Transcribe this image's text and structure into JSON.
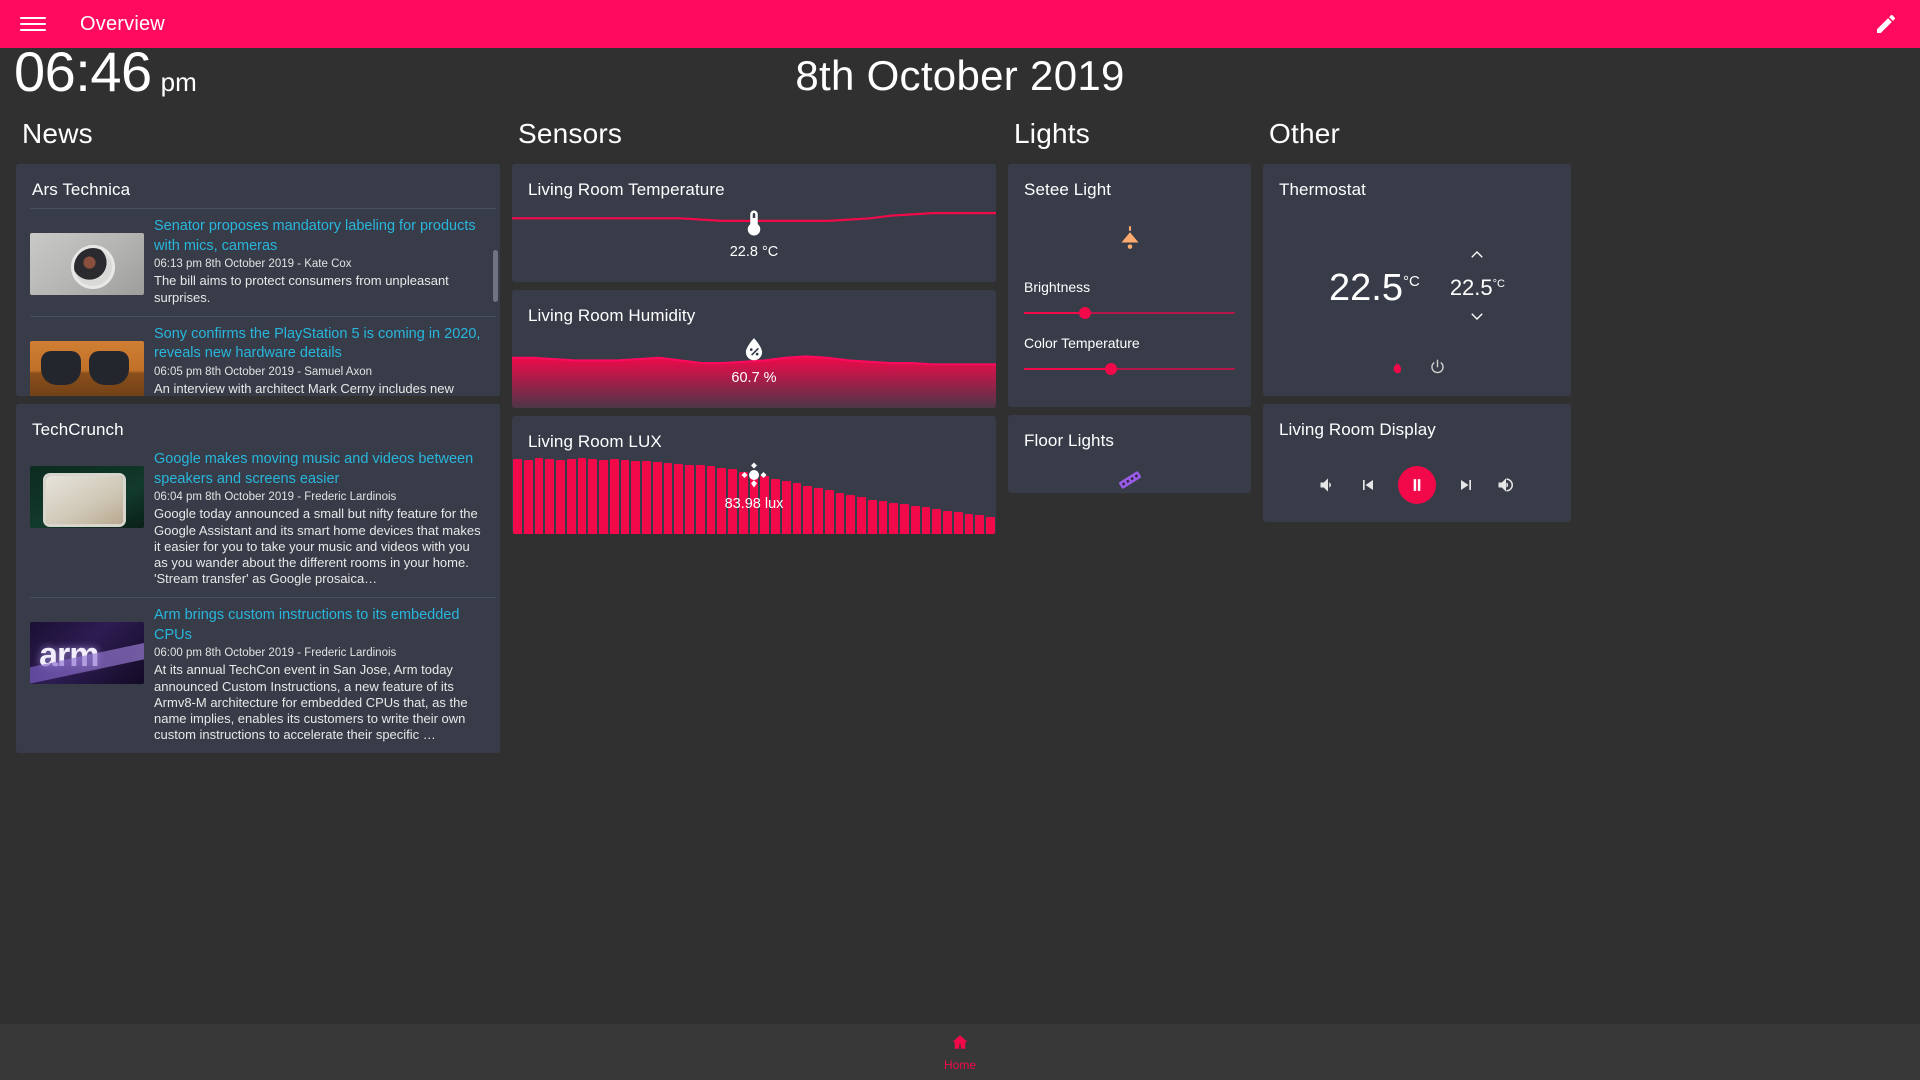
{
  "appbar": {
    "title": "Overview",
    "menu_icon": "hamburger-menu-icon",
    "edit_icon": "pencil-edit-icon"
  },
  "header": {
    "time": "06:46",
    "ampm": "pm",
    "date": "8th October 2019"
  },
  "columns": {
    "news_title": "News",
    "sensors_title": "Sensors",
    "lights_title": "Lights",
    "other_title": "Other"
  },
  "news": [
    {
      "source": "Ars Technica",
      "items": [
        {
          "headline": "Senator proposes mandatory labeling for products with mics, cameras",
          "meta": "06:13 pm 8th October 2019 - Kate Cox",
          "desc": "The bill aims to protect consumers from unpleasant surprises.",
          "thumb": "security-camera-image"
        },
        {
          "headline": "Sony confirms the PlayStation 5 is coming in 2020, reveals new hardware details",
          "meta": "06:05 pm 8th October 2019 - Samuel Axon",
          "desc": "An interview with architect Mark Cerny includes new hardware and software details.",
          "thumb": "playstation-controllers-image"
        }
      ]
    },
    {
      "source": "TechCrunch",
      "items": [
        {
          "headline": "Google makes moving music and videos between speakers and screens easier",
          "meta": "06:04 pm 8th October 2019 - Frederic Lardinois",
          "desc": "Google today announced a small but nifty feature for the Google Assistant and its smart home devices that makes it easier for you to take your music and videos with you as you wander about the different rooms in your home. 'Stream transfer' as Google prosaica…",
          "thumb": "tablet-image"
        },
        {
          "headline": "Arm brings custom instructions to its embedded CPUs",
          "meta": "06:00 pm 8th October 2019 - Frederic Lardinois",
          "desc": "At its annual TechCon event in San Jose, Arm today announced Custom Instructions, a new feature of its Armv8-M architecture for embedded CPUs that, as the name implies, enables its customers to write their own custom instructions to accelerate their specific …",
          "thumb": "arm-logo-image"
        }
      ]
    }
  ],
  "sensors": [
    {
      "title": "Living Room Temperature",
      "value": "22.8 °C",
      "icon": "thermometer-icon",
      "style": "line"
    },
    {
      "title": "Living Room Humidity",
      "value": "60.7 %",
      "icon": "water-percent-icon",
      "style": "area"
    },
    {
      "title": "Living Room LUX",
      "value": "83.98 lux",
      "icon": "brightness-icon",
      "style": "bars"
    }
  ],
  "lights": [
    {
      "title": "Setee Light",
      "icon": "ceiling-light-icon",
      "icon_color": "#ffab70",
      "brightness_label": "Brightness",
      "brightness_pct": 29,
      "color_temp_label": "Color Temperature",
      "color_temp_pct": 41
    },
    {
      "title": "Floor Lights",
      "icon": "led-strip-icon",
      "icon_color": "#9a5ce8"
    }
  ],
  "other": {
    "thermostat": {
      "title": "Thermostat",
      "current": "22.5",
      "current_unit": "°C",
      "target": "22.5",
      "target_unit": "°C",
      "up_icon": "chevron-up-icon",
      "down_icon": "chevron-down-icon",
      "flame_icon": "flame-icon",
      "power_icon": "power-icon"
    },
    "media": {
      "title": "Living Room Display",
      "vol_down_icon": "volume-low-icon",
      "prev_icon": "skip-previous-icon",
      "play_icon": "pause-icon",
      "next_icon": "skip-next-icon",
      "vol_up_icon": "volume-high-icon"
    }
  },
  "bottombar": {
    "home_label": "Home",
    "home_icon": "home-icon"
  },
  "colors": {
    "accent": "#f2094a",
    "appbar": "#ff0a5e",
    "card": "#373c48",
    "background": "#303030",
    "link": "#29b6dd"
  },
  "chart_data": [
    {
      "type": "line",
      "title": "Living Room Temperature",
      "ylabel": "°C",
      "current_value": 22.8,
      "values": [
        22.6,
        22.6,
        22.6,
        22.6,
        22.6,
        22.6,
        22.6,
        22.6,
        22.6,
        22.55,
        22.5,
        22.5,
        22.5,
        22.5,
        22.5,
        22.5,
        22.55,
        22.6,
        22.7,
        22.75,
        22.8,
        22.8,
        22.8,
        22.8
      ],
      "ylim": [
        22.3,
        23.0
      ],
      "grid": false,
      "legend": "none"
    },
    {
      "type": "area",
      "title": "Living Room Humidity",
      "ylabel": "%",
      "current_value": 60.7,
      "values": [
        61.2,
        61.2,
        61.1,
        61.0,
        61.0,
        61.0,
        61.1,
        61.2,
        61.0,
        60.8,
        60.8,
        60.9,
        61.0,
        61.2,
        61.3,
        61.2,
        61.0,
        60.9,
        60.8,
        60.8,
        60.7,
        60.7,
        60.7,
        60.7
      ],
      "ylim": [
        58,
        63
      ],
      "grid": false,
      "legend": "none"
    },
    {
      "type": "bar",
      "title": "Living Room LUX",
      "ylabel": "lux",
      "current_value": 83.98,
      "values": [
        96,
        95,
        97,
        96,
        95,
        96,
        97,
        96,
        95,
        96,
        95,
        94,
        93,
        92,
        91,
        90,
        89,
        88,
        87,
        85,
        83,
        80,
        77,
        74,
        71,
        68,
        65,
        62,
        59,
        56,
        53,
        50,
        47,
        44,
        42,
        40,
        38,
        36,
        34,
        32,
        30,
        28,
        26,
        24,
        22
      ],
      "ylim": [
        0,
        100
      ],
      "grid": false,
      "legend": "none"
    }
  ]
}
